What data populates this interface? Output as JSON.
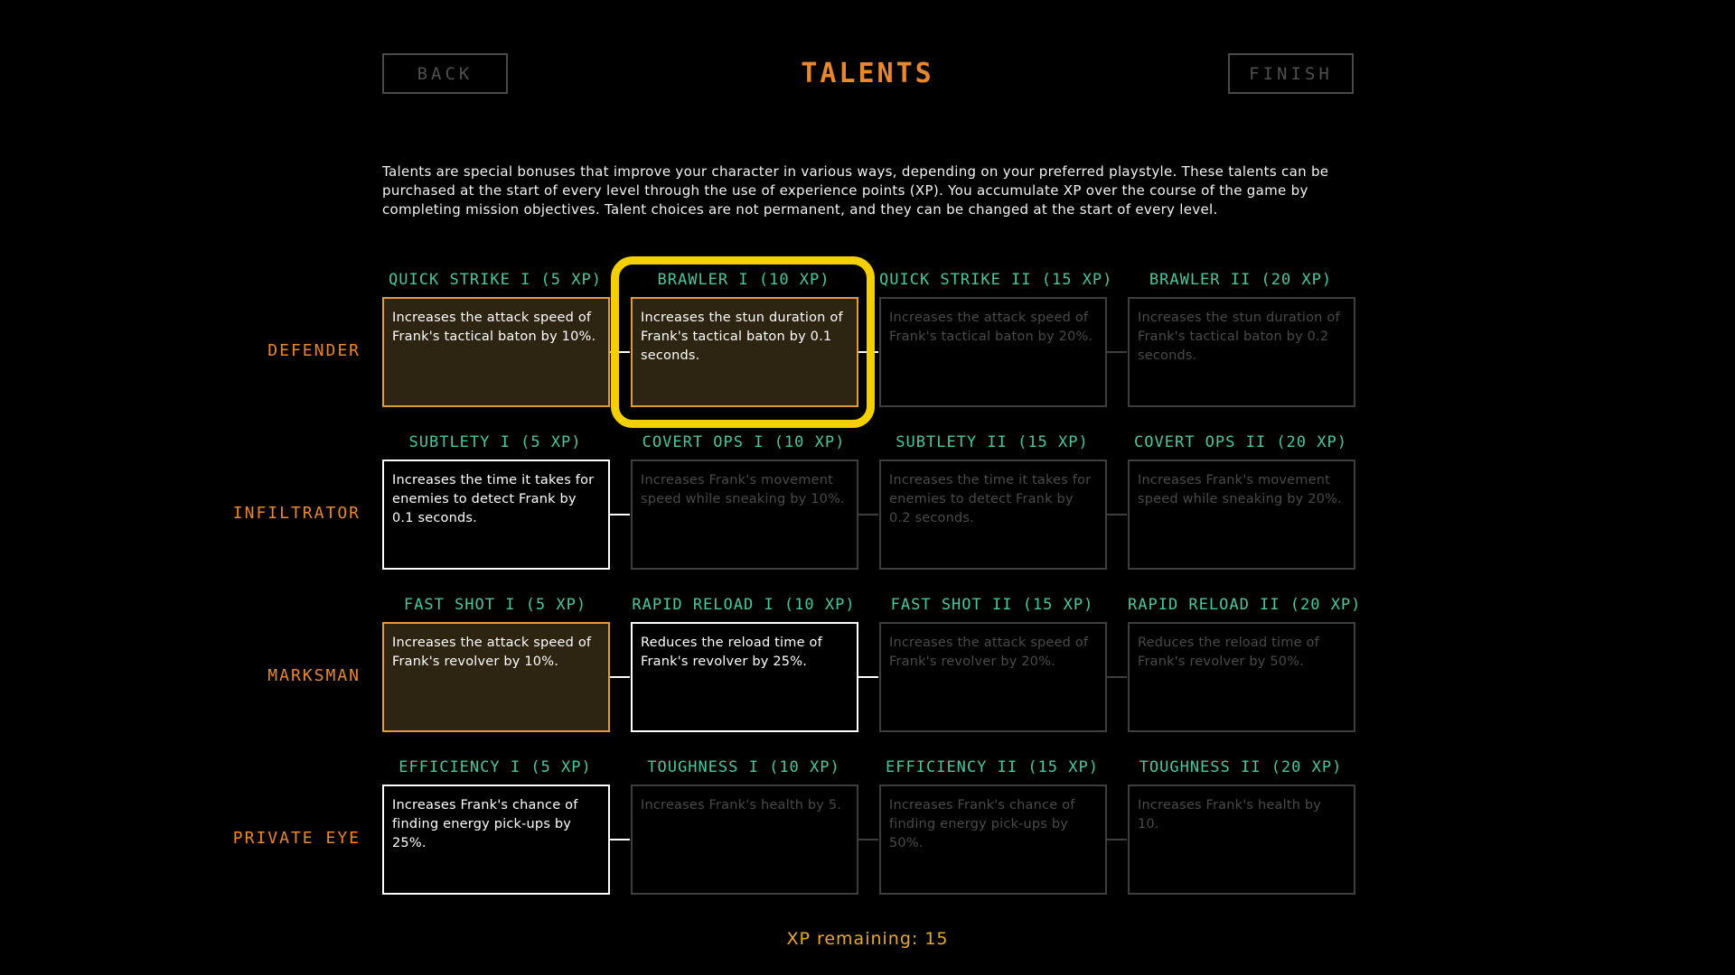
{
  "header": {
    "title": "TALENTS",
    "back_label": "BACK",
    "finish_label": "FINISH"
  },
  "intro": "Talents are special bonuses that improve your character in various ways, depending on your preferred playstyle. These talents can be purchased at the start of every level through the use of experience points (XP). You accumulate XP over the course of the game by completing mission objectives. Talent choices are not permanent, and they can be changed at the start of every level.",
  "rows": [
    {
      "label": "DEFENDER",
      "talents": [
        {
          "title": "QUICK STRIKE I (5 XP)",
          "desc": "Increases the attack speed of Frank's tactical baton by 10%.",
          "state": "purchased"
        },
        {
          "title": "BRAWLER I (10 XP)",
          "desc": "Increases the stun duration of Frank's tactical baton by 0.1 seconds.",
          "state": "selected"
        },
        {
          "title": "QUICK STRIKE II (15 XP)",
          "desc": "Increases the attack speed of Frank's tactical baton by 20%.",
          "state": "locked"
        },
        {
          "title": "BRAWLER II (20 XP)",
          "desc": "Increases the stun duration of Frank's tactical baton by 0.2 seconds.",
          "state": "locked"
        }
      ]
    },
    {
      "label": "INFILTRATOR",
      "talents": [
        {
          "title": "SUBTLETY I (5 XP)",
          "desc": "Increases the time it takes for enemies to detect Frank by 0.1 seconds.",
          "state": "available"
        },
        {
          "title": "COVERT OPS I (10 XP)",
          "desc": "Increases Frank's movement speed while sneaking by 10%.",
          "state": "locked"
        },
        {
          "title": "SUBTLETY II (15 XP)",
          "desc": "Increases the time it takes for enemies to detect Frank by 0.2 seconds.",
          "state": "locked"
        },
        {
          "title": "COVERT OPS II (20 XP)",
          "desc": "Increases Frank's movement speed while sneaking by 20%.",
          "state": "locked"
        }
      ]
    },
    {
      "label": "MARKSMAN",
      "talents": [
        {
          "title": "FAST SHOT I (5 XP)",
          "desc": "Increases the attack speed of Frank's revolver by 10%.",
          "state": "purchased"
        },
        {
          "title": "RAPID RELOAD I (10 XP)",
          "desc": "Reduces the reload time of Frank's revolver by 25%.",
          "state": "available"
        },
        {
          "title": "FAST SHOT II (15 XP)",
          "desc": "Increases the attack speed of Frank's revolver by 20%.",
          "state": "locked"
        },
        {
          "title": "RAPID RELOAD II (20 XP)",
          "desc": "Reduces the reload time of Frank's revolver by 50%.",
          "state": "locked"
        }
      ]
    },
    {
      "label": "PRIVATE EYE",
      "talents": [
        {
          "title": "EFFICIENCY I (5 XP)",
          "desc": "Increases Frank's chance of finding energy pick-ups by 25%.",
          "state": "available"
        },
        {
          "title": "TOUGHNESS I (10 XP)",
          "desc": "Increases Frank's health by 5.",
          "state": "locked"
        },
        {
          "title": "EFFICIENCY II (15 XP)",
          "desc": "Increases Frank's chance of finding energy pick-ups by 50%.",
          "state": "locked"
        },
        {
          "title": "TOUGHNESS II (20 XP)",
          "desc": "Increases Frank's health by 10.",
          "state": "locked"
        }
      ]
    }
  ],
  "footer": {
    "xp_remaining": "XP remaining: 15"
  },
  "colors": {
    "accent_orange": "#e8872b",
    "title_teal": "#48c7a0",
    "focus_yellow": "#f4cf00",
    "purchased_border": "#e39a3a",
    "xp_text": "#e9a928"
  }
}
